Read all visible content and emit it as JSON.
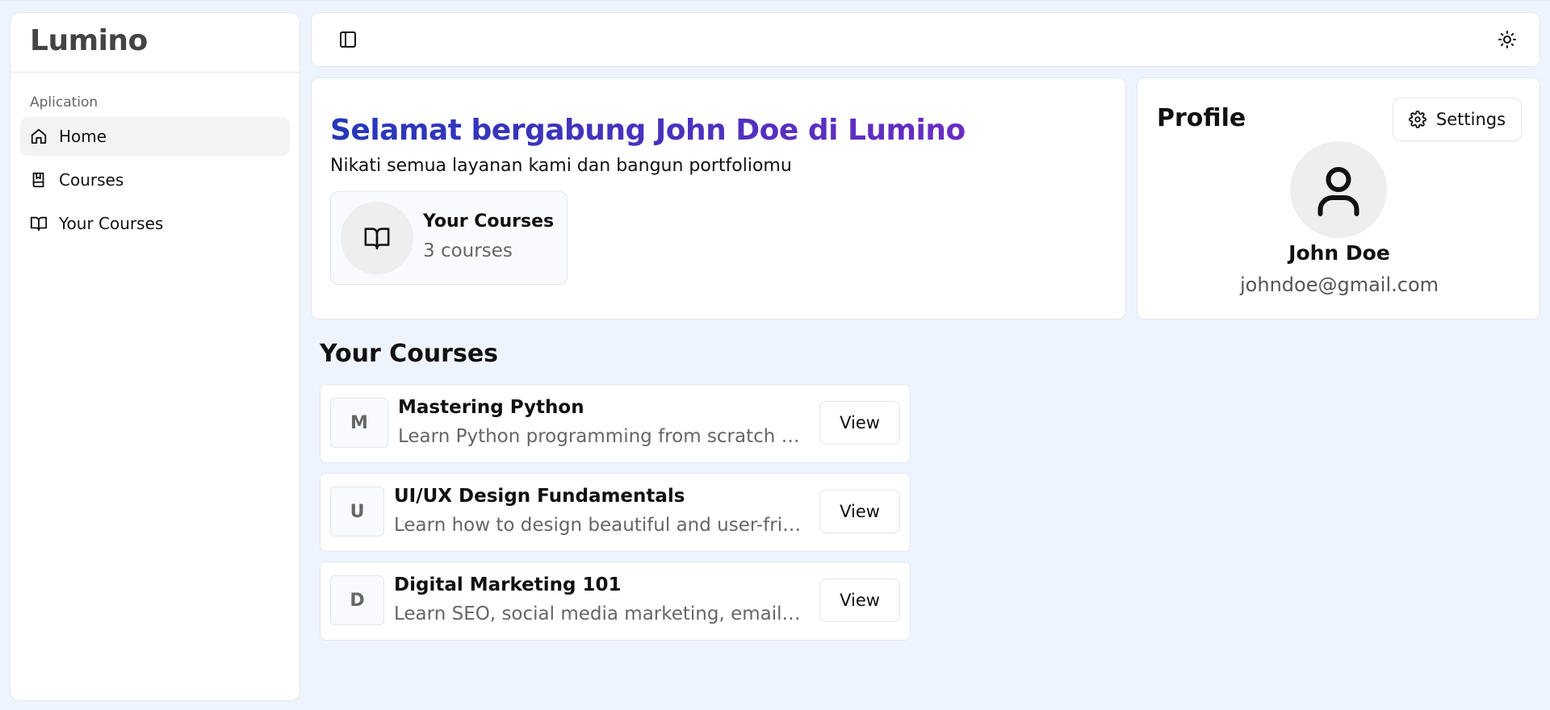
{
  "app": {
    "brand": "Lumino"
  },
  "sidebar": {
    "section_label": "Aplication",
    "items": [
      {
        "label": "Home",
        "icon": "home-icon",
        "active": true
      },
      {
        "label": "Courses",
        "icon": "book-bookmark-icon",
        "active": false
      },
      {
        "label": "Your Courses",
        "icon": "book-open-icon",
        "active": false
      }
    ]
  },
  "topbar": {
    "toggle_icon": "sidebar-toggle-icon",
    "theme_icon": "sun-icon"
  },
  "welcome": {
    "title": "Selamat bergabung John Doe di Lumino",
    "subtitle": "Nikati semua layanan kami dan bangun portfoliomu",
    "stat": {
      "title": "Your Courses",
      "count": "3 courses",
      "icon": "book-open-icon"
    },
    "gradient": [
      "#2438b8",
      "#6a2cc4"
    ]
  },
  "profile": {
    "title": "Profile",
    "settings_label": "Settings",
    "name": "John Doe",
    "email": "johndoe@gmail.com"
  },
  "courses": {
    "heading": "Your Courses",
    "items": [
      {
        "letter": "M",
        "title": "Mastering Python",
        "description": "Learn Python programming from scratch to advanced",
        "action": "View"
      },
      {
        "letter": "U",
        "title": "UI/UX Design Fundamentals",
        "description": "Learn how to design beautiful and user-friendly interfaces",
        "action": "View"
      },
      {
        "letter": "D",
        "title": "Digital Marketing 101",
        "description": "Learn SEO, social media marketing, email marketing and more",
        "action": "View"
      }
    ]
  }
}
